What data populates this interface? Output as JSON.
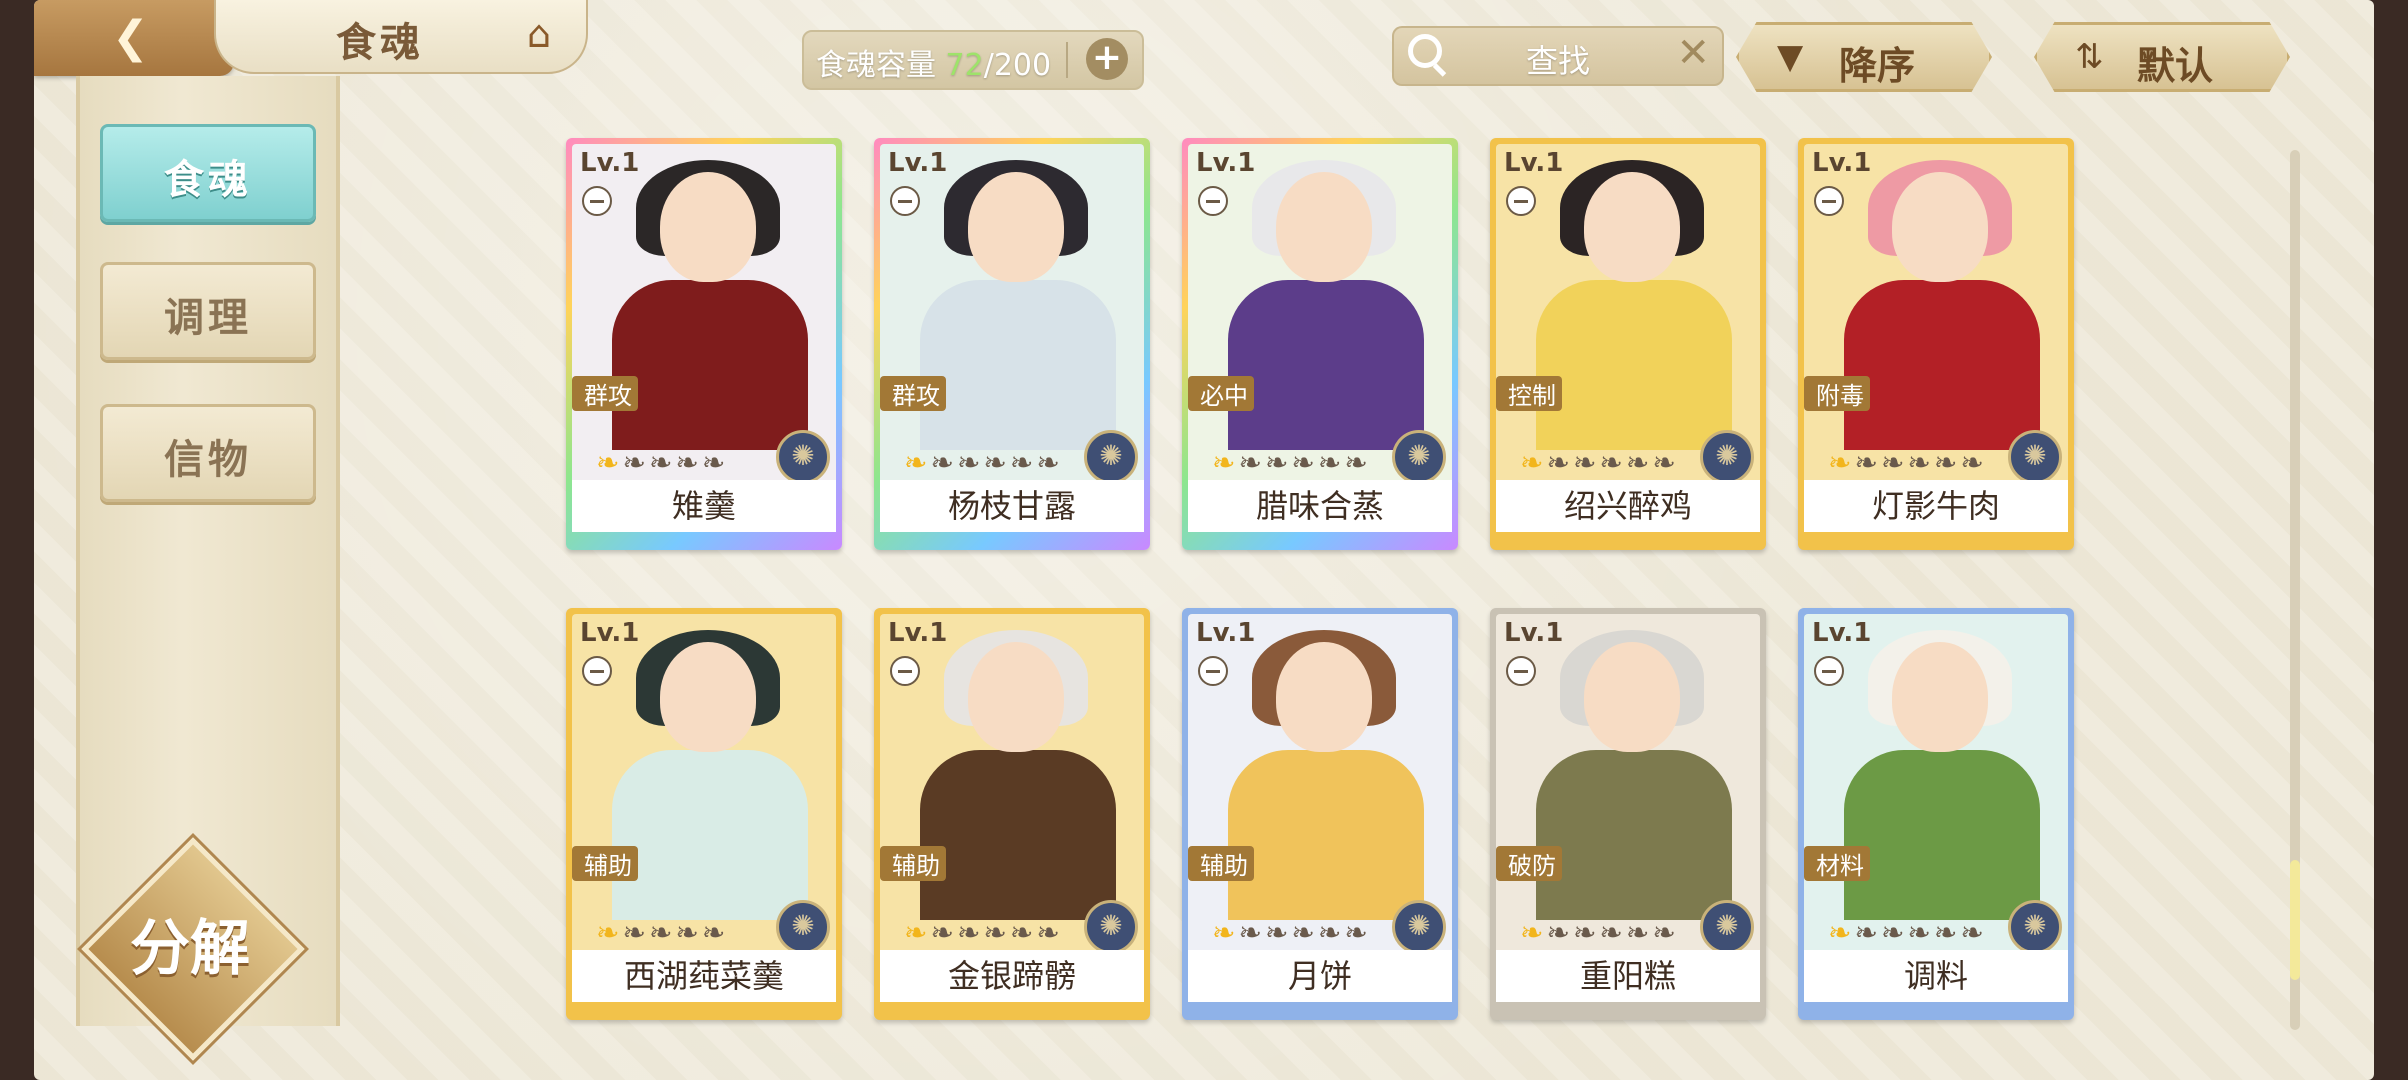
{
  "header": {
    "back_icon": "back-arrow-icon",
    "title": "食魂",
    "home_icon": "home-icon",
    "capacity": {
      "label": "食魂容量",
      "current": "72",
      "total": "/200",
      "add_icon": "plus-icon"
    },
    "search": {
      "placeholder": "查找",
      "clear_icon": "close-icon"
    },
    "sort_button": {
      "label": "降序",
      "icon": "triangle-down-icon"
    },
    "filter_button": {
      "label": "默认",
      "icon": "sort-icon"
    }
  },
  "sidebar": {
    "items": [
      {
        "label": "食魂",
        "active": true
      },
      {
        "label": "调理",
        "active": false
      },
      {
        "label": "信物",
        "active": false
      }
    ],
    "decompose_label": "分解"
  },
  "cards": [
    {
      "level": "Lv.1",
      "role": "群攻",
      "name": "雉羹",
      "stars_lit": 1,
      "stars_total": 5,
      "frame": "rainbow",
      "bg": "#f2eef2",
      "hair": "#2b2727",
      "body": "#7f1c1c"
    },
    {
      "level": "Lv.1",
      "role": "群攻",
      "name": "杨枝甘露",
      "stars_lit": 1,
      "stars_total": 6,
      "frame": "rainbow",
      "bg": "#e6f1ec",
      "hair": "#2d2a30",
      "body": "#d7e2e8"
    },
    {
      "level": "Lv.1",
      "role": "必中",
      "name": "腊味合蒸",
      "stars_lit": 1,
      "stars_total": 6,
      "frame": "rainbow",
      "bg": "#eef4e5",
      "hair": "#e8e8ea",
      "body": "#5c3d8a"
    },
    {
      "level": "Lv.1",
      "role": "控制",
      "name": "绍兴醉鸡",
      "stars_lit": 1,
      "stars_total": 6,
      "frame": "gold",
      "bg": "#f7e3a6",
      "hair": "#2b2424",
      "body": "#f1d25a"
    },
    {
      "level": "Lv.1",
      "role": "附毒",
      "name": "灯影牛肉",
      "stars_lit": 1,
      "stars_total": 6,
      "frame": "gold",
      "bg": "#f7e3a6",
      "hair": "#ee9aa4",
      "body": "#b32026"
    },
    {
      "level": "Lv.1",
      "role": "辅助",
      "name": "西湖莼菜羹",
      "stars_lit": 1,
      "stars_total": 5,
      "frame": "gold",
      "bg": "#f7e3a6",
      "hair": "#2c3835",
      "body": "#d9ece6"
    },
    {
      "level": "Lv.1",
      "role": "辅助",
      "name": "金银蹄髈",
      "stars_lit": 1,
      "stars_total": 6,
      "frame": "gold",
      "bg": "#f7e3a6",
      "hair": "#e7e4e0",
      "body": "#5a3b24"
    },
    {
      "level": "Lv.1",
      "role": "辅助",
      "name": "月饼",
      "stars_lit": 1,
      "stars_total": 6,
      "frame": "blue",
      "bg": "#eef0f6",
      "hair": "#8a5a3a",
      "body": "#f0c35b"
    },
    {
      "level": "Lv.1",
      "role": "破防",
      "name": "重阳糕",
      "stars_lit": 1,
      "stars_total": 6,
      "frame": "silver",
      "bg": "#efe8dc",
      "hair": "#d9d7d2",
      "body": "#7d7a4e"
    },
    {
      "level": "Lv.1",
      "role": "材料",
      "name": "调料",
      "stars_lit": 1,
      "stars_total": 6,
      "frame": "blue",
      "bg": "#e2f2ee",
      "hair": "#f3f1ea",
      "body": "#6c9a45"
    }
  ],
  "colors": {
    "rainbow": "linear-gradient(135deg,#ff8ac0,#ffd35a,#8ee68e,#78c9ff,#c989ff)",
    "gold": "#f2c24a",
    "blue": "#8fb2e8",
    "silver": "#c9c2b4"
  }
}
